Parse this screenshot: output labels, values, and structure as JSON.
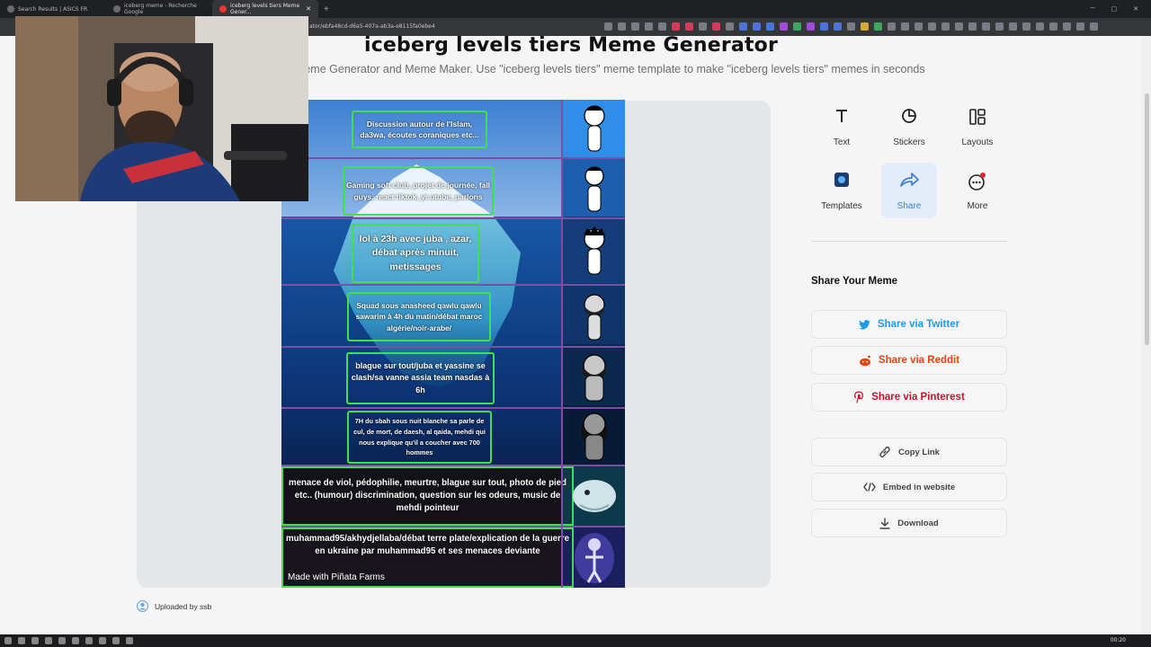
{
  "browser": {
    "tabs": [
      {
        "label": "Search Results | ASICS FR"
      },
      {
        "label": "iceberg meme - Recherche Google"
      },
      {
        "label": "iceberg levels tiers Meme Gener..."
      }
    ],
    "url": "ator/ebfa48cd-d6a5-407a-ab3a-e8115fa0ebe4"
  },
  "page": {
    "title": "iceberg levels tiers Meme Generator",
    "subtitle": "eme Generator and Meme Maker. Use \"iceberg levels tiers\" meme template to make \"iceberg levels tiers\" memes in seconds"
  },
  "meme": {
    "tiers": [
      {
        "text": "Discussion autour de l'Islam, da3wa, écoutes coraniques etc..."
      },
      {
        "text": "Gaming soft club, projet de journée, fall guys, react tiktok, yt utube, parlons"
      },
      {
        "text": "lol à 23h avec juba , azar, débat après minuit, metissages"
      },
      {
        "text": "Squad sous anasheed qawlu qawlu sawarim à 4h du matin/débat maroc algérie/noir-arabe/"
      },
      {
        "text": "blague sur tout/juba et yassine se clash/sa vanne assia team nasdas à 6h"
      },
      {
        "text": "7H du sbah sous nuit blanche sa parle de cul, de mort, de daesh, al qaida, mehdi qui nous explique qu'il a coucher avec 700 hommes"
      },
      {
        "text": "menace de viol, pédophilie, meurtre, blague sur tout, photo de pied etc.. (humour) discrimination, question sur les odeurs, music de mehdi pointeur"
      },
      {
        "text": "muhammad95/akhydjellaba/débat terre plate/explication de la guerre en ukraine par muhammad95 et ses menaces deviante"
      }
    ],
    "watermark": "Made with Piñata Farms"
  },
  "tools": {
    "text": "Text",
    "stickers": "Stickers",
    "layouts": "Layouts",
    "templates": "Templates",
    "share": "Share",
    "more": "More"
  },
  "share": {
    "heading": "Share Your Meme",
    "twitter": "Share via Twitter",
    "reddit": "Share via Reddit",
    "pinterest": "Share via Pinterest",
    "copy_link": "Copy Link",
    "embed": "Embed in website",
    "download": "Download"
  },
  "uploaded_by": "Uploaded by ssb",
  "taskbar": {
    "clock": "00:20"
  },
  "colors": {
    "twitter": "#1d9bf0",
    "reddit": "#e8440f",
    "pinterest": "#c8102e",
    "accent": "#3d7fd1",
    "tier_border": "#3fe04f"
  }
}
